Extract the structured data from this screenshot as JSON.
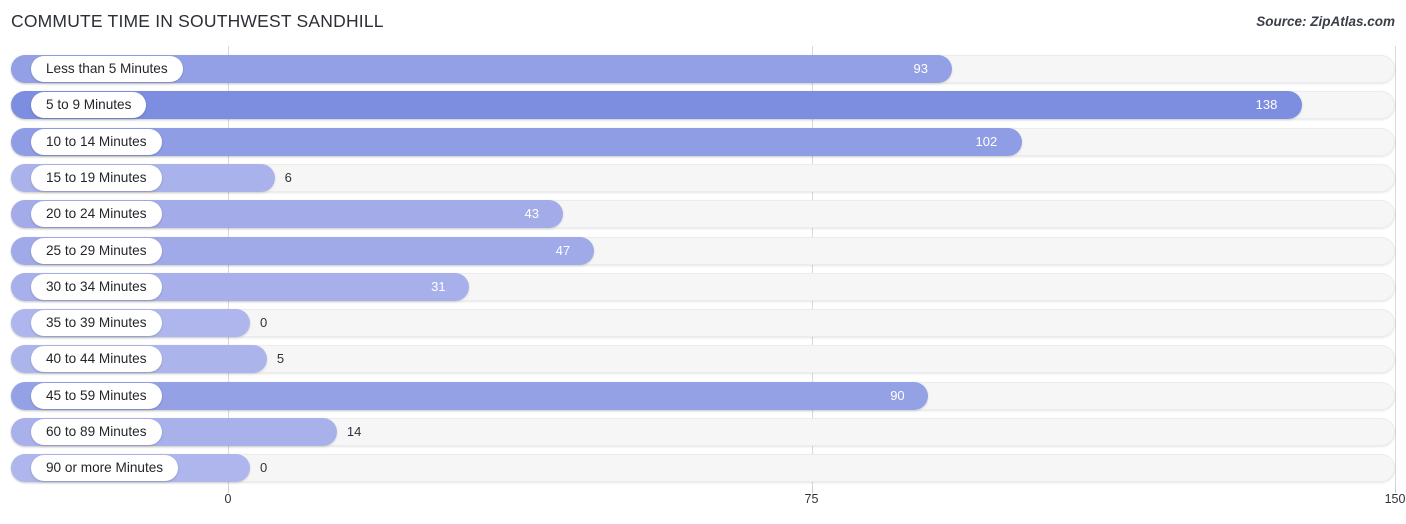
{
  "header": {
    "title": "COMMUTE TIME IN SOUTHWEST SANDHILL",
    "source": "Source: ZipAtlas.com"
  },
  "axis": {
    "ticks": [
      "0",
      "75",
      "150"
    ]
  },
  "chart_data": {
    "type": "bar",
    "orientation": "horizontal",
    "title": "COMMUTE TIME IN SOUTHWEST SANDHILL",
    "subtitle": "Source: ZipAtlas.com",
    "xlabel": "",
    "ylabel": "",
    "xlim": [
      0,
      150
    ],
    "xticks": [
      0,
      75,
      150
    ],
    "grid": true,
    "legend": "none",
    "categories": [
      "Less than 5 Minutes",
      "5 to 9 Minutes",
      "10 to 14 Minutes",
      "15 to 19 Minutes",
      "20 to 24 Minutes",
      "25 to 29 Minutes",
      "30 to 34 Minutes",
      "35 to 39 Minutes",
      "40 to 44 Minutes",
      "45 to 59 Minutes",
      "60 to 89 Minutes",
      "90 or more Minutes"
    ],
    "values": [
      93,
      138,
      102,
      6,
      43,
      47,
      31,
      0,
      5,
      90,
      14,
      0
    ],
    "value_labels": [
      "93",
      "138",
      "102",
      "6",
      "43",
      "47",
      "31",
      "0",
      "5",
      "90",
      "14",
      "0"
    ],
    "bar_colors": [
      "#93a0e5",
      "#7d8ee0",
      "#8f9de4",
      "#aab2ec",
      "#a3ace9",
      "#a1aae9",
      "#a7b0eb",
      "#aeb6ed",
      "#acb4ec",
      "#94a1e5",
      "#a9b1eb",
      "#aeb6ed"
    ],
    "track_color": "#f6f6f7",
    "gridline_color": "#d9d9d9"
  }
}
